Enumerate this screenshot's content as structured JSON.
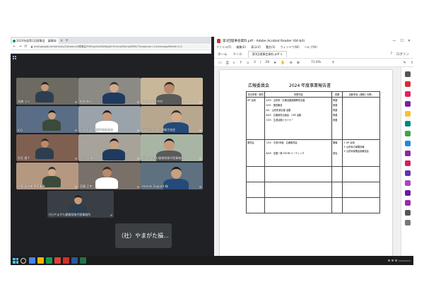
{
  "browser": {
    "tab_title": "2024年度第1回理事会　議事録",
    "tab_close": "×",
    "new_tab": "+",
    "url": "mail.google.com/mail/u/0/#search/理事会/FMfcgzGtxSWdKgZmFvhrqVNkmpIWRtzT?projector=1&messagePartId=0.2",
    "back": "←",
    "forward": "→",
    "reload": "⟳"
  },
  "meet": {
    "tiles": [
      {
        "label": "高橋 十二",
        "bg": "#6d6a62"
      },
      {
        "label": "柏原 和行",
        "bg": "#8c8a85"
      },
      {
        "label": "プロバイダ 中村",
        "bg": "#c9b79a"
      },
      {
        "label": "K'O",
        "bg": "#5a6d86"
      },
      {
        "label": "(一社)山形県観光物産協会",
        "bg": "#9aa3a9"
      },
      {
        "label": "(一社)山形県公衆衛生協会",
        "bg": "#b8a78f"
      },
      {
        "label": "雨宮 優子",
        "bg": "#7f5f50"
      },
      {
        "label": "大川 英 真",
        "bg": "#a7a39a"
      },
      {
        "label": "(社)やまがた健康保険代理事務所",
        "bg": "#a9b5a4"
      },
      {
        "label": "佐藤 真由美 関東事務",
        "bg": "#b59880"
      },
      {
        "label": "斎藤 正幸",
        "bg": "#79706a"
      },
      {
        "label": "Human Support 株",
        "bg": "#5d7180"
      },
      {
        "label": "(社)やまがた健康保険代理事務所",
        "bg": "#3a3f45"
      }
    ],
    "overlay_name": "（社）やまがた損..."
  },
  "acrobat": {
    "window_title": "第3回理事会資料.pdf - Adobe Acrobat Reader (64-bit)",
    "win_min": "—",
    "win_max": "☐",
    "win_close": "✕",
    "menu": [
      "ファイル(F)",
      "編集(E)",
      "表示(V)",
      "署名(S)",
      "ウィンドウ(W)",
      "ヘルプ(H)"
    ],
    "tabs": {
      "home": "ホーム",
      "tools": "ツール",
      "doc": "第3回理事会資料.pdf",
      "doc_close": "×",
      "help": "?",
      "login": "ログイン"
    },
    "toolbar": {
      "page_current": "3",
      "page_sep": "/",
      "page_total": "29",
      "zoom": "71.6%",
      "zoom_arrow": "▾"
    }
  },
  "report": {
    "committee": "広報委員会",
    "title": "2024 年度事業報告書",
    "headers": [
      "担当事業／委員",
      "事業内容",
      "成果",
      "活動事項（課題と対策）"
    ],
    "rows": [
      {
        "group": "HP 活用",
        "items": [
          "4/30　山形県・広報活動連絡等担当者",
          "5/31　運営報告",
          "6/1　山形県宣伝部 活動",
          "6/20　広報部担当者会　CSR 活動",
          "7/25　生涯活動とセミナー"
        ],
        "results": [
          "掲載",
          "掲載",
          "掲載",
          "掲載",
          "掲載"
        ],
        "notes": ""
      },
      {
        "group": "委員会",
        "items": [
          "7/24　平成5年度　広報委員会",
          "8/29　全国一斉 ZOOM ミーティング"
        ],
        "results": [
          "開催",
          "参加"
        ],
        "notes": "① HP 活用\n② 山形県の保険情報\n③ 山形県保険会議報告会"
      }
    ]
  },
  "taskbar": {
    "clock": "2024/08/25"
  },
  "colors": {
    "accent_acrobat": "#d32f2f",
    "meet_bg": "#202124",
    "taskbar": "#1c1c1c"
  }
}
